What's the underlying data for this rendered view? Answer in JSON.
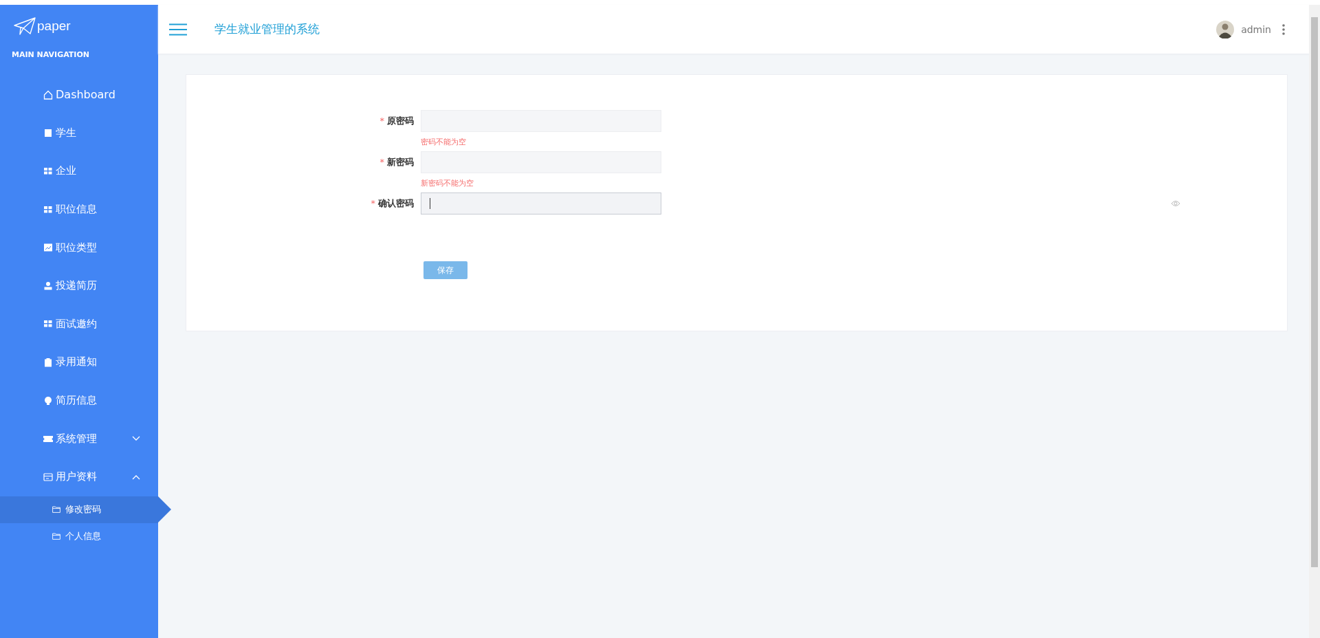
{
  "sidebar": {
    "logo": "paper",
    "section_title": "MAIN NAVIGATION",
    "items": [
      {
        "label": "Dashboard",
        "kind": "home"
      },
      {
        "label": "学生",
        "kind": "doc"
      },
      {
        "label": "企业",
        "kind": "grid"
      },
      {
        "label": "职位信息",
        "kind": "grid"
      },
      {
        "label": "职位类型",
        "kind": "chart"
      },
      {
        "label": "投递简历",
        "kind": "person"
      },
      {
        "label": "面试邀约",
        "kind": "grid"
      },
      {
        "label": "录用通知",
        "kind": "clipboard"
      },
      {
        "label": "简历信息",
        "kind": "bulb"
      },
      {
        "label": "系统管理",
        "kind": "ticket",
        "expanded": false
      },
      {
        "label": "用户资料",
        "kind": "window",
        "expanded": true,
        "children": [
          {
            "label": "修改密码",
            "selected": true
          },
          {
            "label": "个人信息",
            "selected": false
          }
        ]
      }
    ]
  },
  "header": {
    "title": "学生就业管理的系统",
    "user": "admin"
  },
  "form": {
    "fields": [
      {
        "label": "原密码",
        "required_mark": "*",
        "focused": false,
        "error": "密码不能为空"
      },
      {
        "label": "新密码",
        "required_mark": "*",
        "focused": false,
        "error": "新密码不能为空"
      },
      {
        "label": "确认密码",
        "required_mark": "*",
        "focused": true,
        "password_toggle": true
      }
    ],
    "submit": "保存"
  }
}
